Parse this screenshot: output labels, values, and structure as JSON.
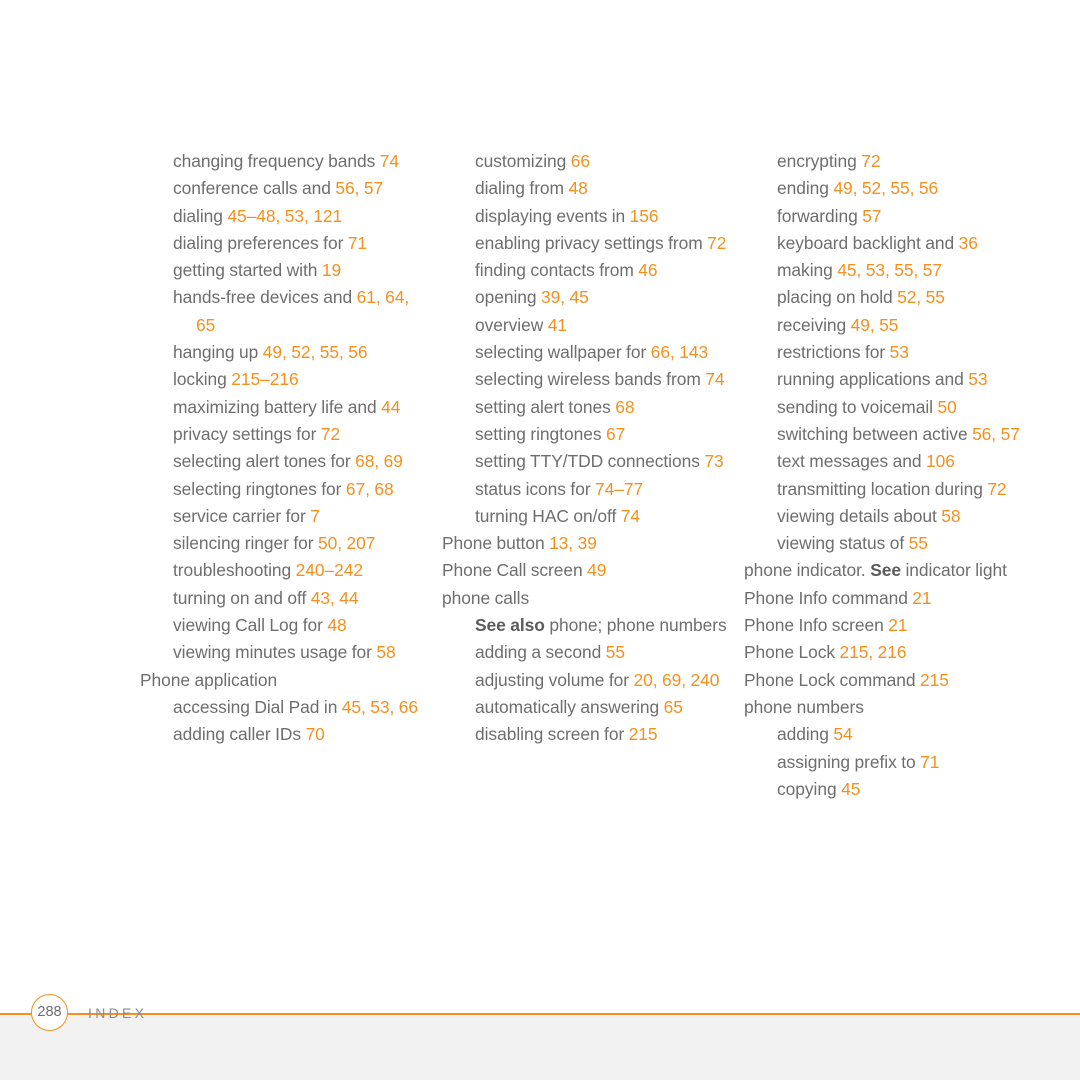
{
  "page": {
    "background_color": "#ffffff",
    "accent_color": "#f5901e",
    "text_color": "#6e6e6e"
  },
  "footer": {
    "page_number": "288",
    "section_label": "INDEX",
    "rule_color": "#f5901e"
  },
  "columns": [
    {
      "id": "column-1",
      "entries": [
        {
          "level": 1,
          "parts": [
            {
              "t": "changing frequency bands ",
              "k": "text"
            },
            {
              "t": "74",
              "k": "num"
            }
          ]
        },
        {
          "level": 1,
          "parts": [
            {
              "t": "conference calls and ",
              "k": "text"
            },
            {
              "t": "56, 57",
              "k": "num"
            }
          ]
        },
        {
          "level": 1,
          "parts": [
            {
              "t": "dialing ",
              "k": "text"
            },
            {
              "t": "45–48, 53, 121",
              "k": "num"
            }
          ]
        },
        {
          "level": 1,
          "parts": [
            {
              "t": "dialing preferences for ",
              "k": "text"
            },
            {
              "t": "71",
              "k": "num"
            }
          ]
        },
        {
          "level": 1,
          "parts": [
            {
              "t": "getting started with ",
              "k": "text"
            },
            {
              "t": "19",
              "k": "num"
            }
          ]
        },
        {
          "level": 1,
          "parts": [
            {
              "t": "hands-free devices and ",
              "k": "text"
            },
            {
              "t": "61, 64, 65",
              "k": "num"
            }
          ]
        },
        {
          "level": 1,
          "parts": [
            {
              "t": "hanging up ",
              "k": "text"
            },
            {
              "t": "49, 52, 55, 56",
              "k": "num"
            }
          ]
        },
        {
          "level": 1,
          "parts": [
            {
              "t": "locking ",
              "k": "text"
            },
            {
              "t": "215–216",
              "k": "num"
            }
          ]
        },
        {
          "level": 1,
          "parts": [
            {
              "t": "maximizing battery life and ",
              "k": "text"
            },
            {
              "t": "44",
              "k": "num"
            }
          ]
        },
        {
          "level": 1,
          "parts": [
            {
              "t": "privacy settings for ",
              "k": "text"
            },
            {
              "t": "72",
              "k": "num"
            }
          ]
        },
        {
          "level": 1,
          "parts": [
            {
              "t": "selecting alert tones for ",
              "k": "text"
            },
            {
              "t": "68, 69",
              "k": "num"
            }
          ]
        },
        {
          "level": 1,
          "parts": [
            {
              "t": "selecting ringtones for ",
              "k": "text"
            },
            {
              "t": "67, 68",
              "k": "num"
            }
          ]
        },
        {
          "level": 1,
          "parts": [
            {
              "t": "service carrier for ",
              "k": "text"
            },
            {
              "t": "7",
              "k": "num"
            }
          ]
        },
        {
          "level": 1,
          "parts": [
            {
              "t": "silencing ringer for ",
              "k": "text"
            },
            {
              "t": "50, 207",
              "k": "num"
            }
          ]
        },
        {
          "level": 1,
          "parts": [
            {
              "t": "troubleshooting ",
              "k": "text"
            },
            {
              "t": "240–242",
              "k": "num"
            }
          ]
        },
        {
          "level": 1,
          "parts": [
            {
              "t": "turning on and off ",
              "k": "text"
            },
            {
              "t": "43, 44",
              "k": "num"
            }
          ]
        },
        {
          "level": 1,
          "parts": [
            {
              "t": "viewing Call Log for ",
              "k": "text"
            },
            {
              "t": "48",
              "k": "num"
            }
          ]
        },
        {
          "level": 1,
          "parts": [
            {
              "t": "viewing minutes usage for ",
              "k": "text"
            },
            {
              "t": "58",
              "k": "num"
            }
          ]
        },
        {
          "level": 0,
          "parts": [
            {
              "t": "Phone application",
              "k": "text"
            }
          ]
        },
        {
          "level": 1,
          "parts": [
            {
              "t": "accessing Dial Pad in ",
              "k": "text"
            },
            {
              "t": "45, 53, 66",
              "k": "num"
            }
          ]
        },
        {
          "level": 1,
          "parts": [
            {
              "t": "adding caller IDs ",
              "k": "text"
            },
            {
              "t": "70",
              "k": "num"
            }
          ]
        }
      ]
    },
    {
      "id": "column-2",
      "entries": [
        {
          "level": 1,
          "parts": [
            {
              "t": "customizing ",
              "k": "text"
            },
            {
              "t": "66",
              "k": "num"
            }
          ]
        },
        {
          "level": 1,
          "parts": [
            {
              "t": "dialing from ",
              "k": "text"
            },
            {
              "t": "48",
              "k": "num"
            }
          ]
        },
        {
          "level": 1,
          "parts": [
            {
              "t": "displaying events in ",
              "k": "text"
            },
            {
              "t": "156",
              "k": "num"
            }
          ]
        },
        {
          "level": 1,
          "parts": [
            {
              "t": "enabling privacy settings from ",
              "k": "text"
            },
            {
              "t": "72",
              "k": "num"
            }
          ]
        },
        {
          "level": 1,
          "parts": [
            {
              "t": "finding contacts from ",
              "k": "text"
            },
            {
              "t": "46",
              "k": "num"
            }
          ]
        },
        {
          "level": 1,
          "parts": [
            {
              "t": "opening ",
              "k": "text"
            },
            {
              "t": "39, 45",
              "k": "num"
            }
          ]
        },
        {
          "level": 1,
          "parts": [
            {
              "t": "overview ",
              "k": "text"
            },
            {
              "t": "41",
              "k": "num"
            }
          ]
        },
        {
          "level": 1,
          "parts": [
            {
              "t": "selecting wallpaper for ",
              "k": "text"
            },
            {
              "t": "66, 143",
              "k": "num"
            }
          ]
        },
        {
          "level": 1,
          "parts": [
            {
              "t": "selecting wireless bands from ",
              "k": "text"
            },
            {
              "t": "74",
              "k": "num"
            }
          ]
        },
        {
          "level": 1,
          "parts": [
            {
              "t": "setting alert tones ",
              "k": "text"
            },
            {
              "t": "68",
              "k": "num"
            }
          ]
        },
        {
          "level": 1,
          "parts": [
            {
              "t": "setting ringtones ",
              "k": "text"
            },
            {
              "t": "67",
              "k": "num"
            }
          ]
        },
        {
          "level": 1,
          "parts": [
            {
              "t": "setting TTY/TDD connections ",
              "k": "text"
            },
            {
              "t": "73",
              "k": "num"
            }
          ]
        },
        {
          "level": 1,
          "parts": [
            {
              "t": "status icons for ",
              "k": "text"
            },
            {
              "t": "74–77",
              "k": "num"
            }
          ]
        },
        {
          "level": 1,
          "parts": [
            {
              "t": "turning HAC on/off ",
              "k": "text"
            },
            {
              "t": "74",
              "k": "num"
            }
          ]
        },
        {
          "level": 0,
          "parts": [
            {
              "t": "Phone button ",
              "k": "text"
            },
            {
              "t": "13, 39",
              "k": "num"
            }
          ]
        },
        {
          "level": 0,
          "parts": [
            {
              "t": "Phone Call screen ",
              "k": "text"
            },
            {
              "t": "49",
              "k": "num"
            }
          ]
        },
        {
          "level": 0,
          "parts": [
            {
              "t": "phone calls",
              "k": "text"
            }
          ]
        },
        {
          "level": 1,
          "parts": [
            {
              "t": "See also",
              "k": "xref"
            },
            {
              "t": " phone; phone numbers",
              "k": "text"
            }
          ]
        },
        {
          "level": 1,
          "parts": [
            {
              "t": "adding a second ",
              "k": "text"
            },
            {
              "t": "55",
              "k": "num"
            }
          ]
        },
        {
          "level": 1,
          "parts": [
            {
              "t": "adjusting volume for ",
              "k": "text"
            },
            {
              "t": "20, 69, 240",
              "k": "num"
            }
          ]
        },
        {
          "level": 1,
          "parts": [
            {
              "t": "automatically answering ",
              "k": "text"
            },
            {
              "t": "65",
              "k": "num"
            }
          ]
        },
        {
          "level": 1,
          "parts": [
            {
              "t": "disabling screen for ",
              "k": "text"
            },
            {
              "t": "215",
              "k": "num"
            }
          ]
        }
      ]
    },
    {
      "id": "column-3",
      "entries": [
        {
          "level": 1,
          "parts": [
            {
              "t": "encrypting ",
              "k": "text"
            },
            {
              "t": "72",
              "k": "num"
            }
          ]
        },
        {
          "level": 1,
          "parts": [
            {
              "t": "ending ",
              "k": "text"
            },
            {
              "t": "49, 52, 55, 56",
              "k": "num"
            }
          ]
        },
        {
          "level": 1,
          "parts": [
            {
              "t": "forwarding ",
              "k": "text"
            },
            {
              "t": "57",
              "k": "num"
            }
          ]
        },
        {
          "level": 1,
          "parts": [
            {
              "t": "keyboard backlight and ",
              "k": "text"
            },
            {
              "t": "36",
              "k": "num"
            }
          ]
        },
        {
          "level": 1,
          "parts": [
            {
              "t": "making ",
              "k": "text"
            },
            {
              "t": "45, 53, 55, 57",
              "k": "num"
            }
          ]
        },
        {
          "level": 1,
          "parts": [
            {
              "t": "placing on hold ",
              "k": "text"
            },
            {
              "t": "52, 55",
              "k": "num"
            }
          ]
        },
        {
          "level": 1,
          "parts": [
            {
              "t": "receiving ",
              "k": "text"
            },
            {
              "t": "49, 55",
              "k": "num"
            }
          ]
        },
        {
          "level": 1,
          "parts": [
            {
              "t": "restrictions for ",
              "k": "text"
            },
            {
              "t": "53",
              "k": "num"
            }
          ]
        },
        {
          "level": 1,
          "parts": [
            {
              "t": "running applications and ",
              "k": "text"
            },
            {
              "t": "53",
              "k": "num"
            }
          ]
        },
        {
          "level": 1,
          "parts": [
            {
              "t": "sending to voicemail ",
              "k": "text"
            },
            {
              "t": "50",
              "k": "num"
            }
          ]
        },
        {
          "level": 1,
          "parts": [
            {
              "t": "switching between active ",
              "k": "text"
            },
            {
              "t": "56, 57",
              "k": "num"
            }
          ]
        },
        {
          "level": 1,
          "parts": [
            {
              "t": "text messages and ",
              "k": "text"
            },
            {
              "t": "106",
              "k": "num"
            }
          ]
        },
        {
          "level": 1,
          "parts": [
            {
              "t": "transmitting location during ",
              "k": "text"
            },
            {
              "t": "72",
              "k": "num"
            }
          ]
        },
        {
          "level": 1,
          "parts": [
            {
              "t": "viewing details about ",
              "k": "text"
            },
            {
              "t": "58",
              "k": "num"
            }
          ]
        },
        {
          "level": 1,
          "parts": [
            {
              "t": "viewing status of ",
              "k": "text"
            },
            {
              "t": "55",
              "k": "num"
            }
          ]
        },
        {
          "level": 0,
          "parts": [
            {
              "t": "phone indicator. ",
              "k": "text"
            },
            {
              "t": "See",
              "k": "xref"
            },
            {
              "t": " indicator light",
              "k": "text"
            }
          ]
        },
        {
          "level": 0,
          "parts": [
            {
              "t": "Phone Info command ",
              "k": "text"
            },
            {
              "t": "21",
              "k": "num"
            }
          ]
        },
        {
          "level": 0,
          "parts": [
            {
              "t": "Phone Info screen ",
              "k": "text"
            },
            {
              "t": "21",
              "k": "num"
            }
          ]
        },
        {
          "level": 0,
          "parts": [
            {
              "t": "Phone Lock ",
              "k": "text"
            },
            {
              "t": "215, 216",
              "k": "num"
            }
          ]
        },
        {
          "level": 0,
          "parts": [
            {
              "t": "Phone Lock command ",
              "k": "text"
            },
            {
              "t": "215",
              "k": "num"
            }
          ]
        },
        {
          "level": 0,
          "parts": [
            {
              "t": "phone numbers",
              "k": "text"
            }
          ]
        },
        {
          "level": 1,
          "parts": [
            {
              "t": "adding ",
              "k": "text"
            },
            {
              "t": "54",
              "k": "num"
            }
          ]
        },
        {
          "level": 1,
          "parts": [
            {
              "t": "assigning prefix to ",
              "k": "text"
            },
            {
              "t": "71",
              "k": "num"
            }
          ]
        },
        {
          "level": 1,
          "parts": [
            {
              "t": "copying ",
              "k": "text"
            },
            {
              "t": "45",
              "k": "num"
            }
          ]
        }
      ]
    }
  ]
}
